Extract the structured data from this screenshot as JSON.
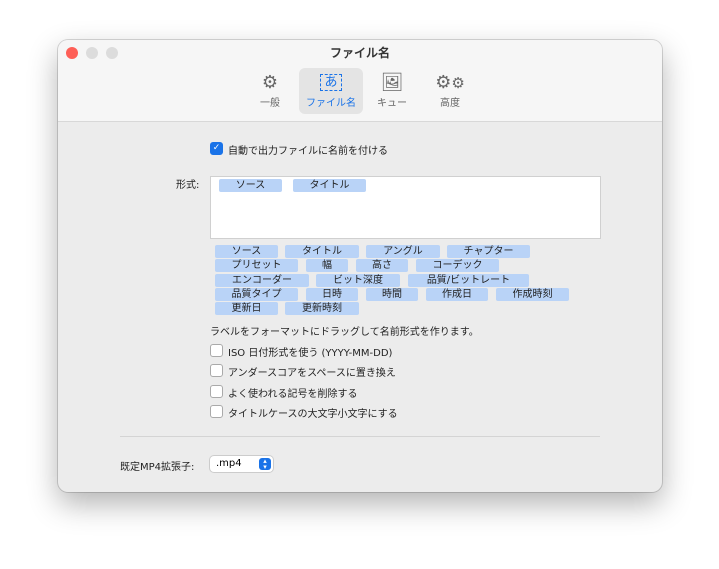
{
  "window": {
    "title": "ファイル名"
  },
  "toolbar": {
    "tabs": [
      {
        "label": "一般",
        "icon": "gear-icon"
      },
      {
        "label": "ファイル名",
        "icon": "filename-icon"
      },
      {
        "label": "キュー",
        "icon": "queue-icon"
      },
      {
        "label": "高度",
        "icon": "advanced-gears-icon"
      }
    ],
    "selected": "ファイル名"
  },
  "auto_name": {
    "label": "自動で出力ファイルに名前を付ける",
    "checked": true
  },
  "format": {
    "label": "形式:",
    "tokens": [
      "ソース",
      "タイトル"
    ]
  },
  "available_tokens": [
    "ソース",
    "タイトル",
    "アングル",
    "チャプター",
    "プリセット",
    "幅",
    "高さ",
    "コーデック",
    "エンコーダー",
    "ビット深度",
    "品質/ビットレート",
    "品質タイプ",
    "日時",
    "時間",
    "作成日",
    "作成時刻",
    "更新日",
    "更新時刻"
  ],
  "hint": "ラベルをフォーマットにドラッグして名前形式を作ります。",
  "options": [
    {
      "label": "ISO 日付形式を使う (YYYY-MM-DD)",
      "checked": false
    },
    {
      "label": "アンダースコアをスペースに置き換え",
      "checked": false
    },
    {
      "label": "よく使われる記号を削除する",
      "checked": false
    },
    {
      "label": "タイトルケースの大文字小文字にする",
      "checked": false
    }
  ],
  "extension": {
    "label": "既定MP4拡張子:",
    "value": ".mp4"
  },
  "colors": {
    "accent": "#1a73e8",
    "token": "#b9d3f7"
  }
}
